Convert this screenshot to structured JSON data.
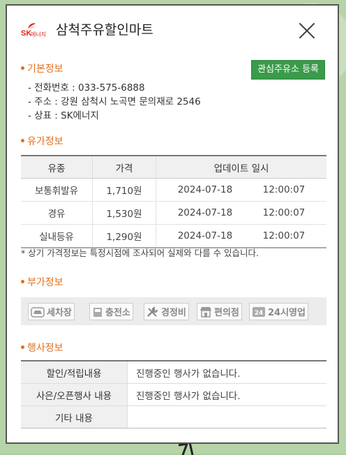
{
  "header": {
    "logo_sk": "SK",
    "logo_text": "에너지",
    "title": "삼척주유할인마트"
  },
  "basic": {
    "title": "기본정보",
    "fav_button": "관심주유소 등록",
    "phone": "- 전화번호 : 033-575-6888",
    "address": "- 주소 : 강원 삼척시 노곡면 문의재로 2546",
    "brand": "- 상표 : SK에너지"
  },
  "price": {
    "title": "유가정보",
    "headers": [
      "유종",
      "가격",
      "업데이트 일시"
    ],
    "rows": [
      {
        "type": "보통휘발유",
        "price": "1,710원",
        "date": "2024-07-18",
        "time": "12:00:07"
      },
      {
        "type": "경유",
        "price": "1,530원",
        "date": "2024-07-18",
        "time": "12:00:07"
      },
      {
        "type": "실내등유",
        "price": "1,290원",
        "date": "2024-07-18",
        "time": "12:00:07"
      }
    ],
    "note": "* 상기 가격정보는 특정시점에 조사되어 실제와 다를 수 있습니다."
  },
  "extra": {
    "title": "부가정보",
    "services": [
      "세차장",
      "충전소",
      "경정비",
      "편의점",
      "24시영업"
    ]
  },
  "event": {
    "title": "행사정보",
    "rows": [
      {
        "label": "할인/적립내용",
        "value": "진행중인 행사가 없습니다."
      },
      {
        "label": "사은/오픈행사 내용",
        "value": "진행중인 행사가 없습니다."
      },
      {
        "label": "기타 내용",
        "value": ""
      }
    ]
  },
  "colors": {
    "accent": "#e2701c",
    "button": "#3a9b4a",
    "brand_red": "#e2231a"
  }
}
